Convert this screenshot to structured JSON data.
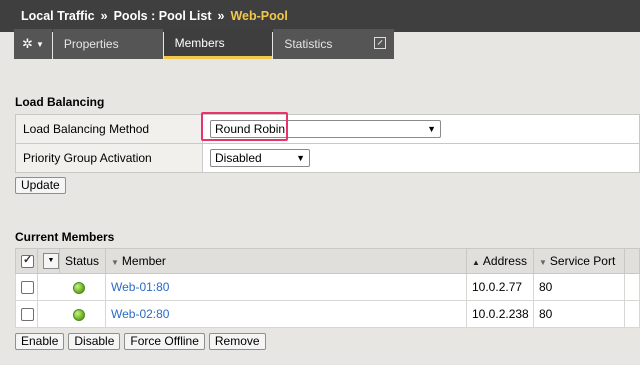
{
  "breadcrumb": {
    "items": [
      "Local Traffic",
      "Pools : Pool List"
    ],
    "separator": "»",
    "current": "Web-Pool"
  },
  "tabs": {
    "properties": "Properties",
    "members": "Members",
    "statistics": "Statistics"
  },
  "load_balancing": {
    "title": "Load Balancing",
    "method_label": "Load Balancing Method",
    "method_value": "Round Robin",
    "priority_label": "Priority Group Activation",
    "priority_value": "Disabled",
    "update_button": "Update"
  },
  "current_members": {
    "title": "Current Members",
    "columns": {
      "status": "Status",
      "member": "Member",
      "address": "Address",
      "service_port": "Service Port"
    },
    "rows": [
      {
        "member": "Web-01:80",
        "address": "10.0.2.77",
        "port": "80",
        "status_color": "#6cb322"
      },
      {
        "member": "Web-02:80",
        "address": "10.0.2.238",
        "port": "80",
        "status_color": "#6cb322"
      }
    ],
    "actions": {
      "enable": "Enable",
      "disable": "Disable",
      "force_offline": "Force Offline",
      "remove": "Remove"
    }
  },
  "colors": {
    "accent": "#f2c84b",
    "highlight": "#e8336b",
    "link": "#2a6bc4"
  }
}
